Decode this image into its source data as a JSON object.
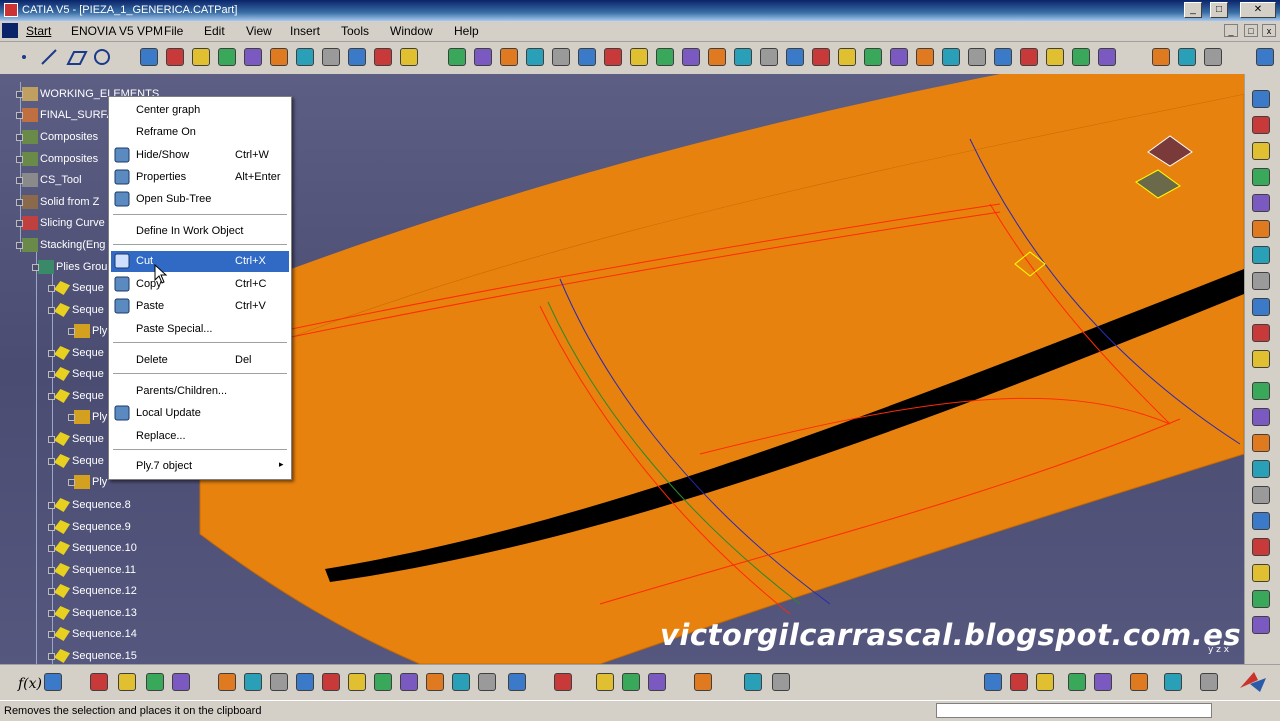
{
  "window": {
    "title": "CATIA V5 - [PIEZA_1_GENERICA.CATPart]"
  },
  "menu": [
    "Start",
    "ENOVIA V5 VPM",
    "File",
    "Edit",
    "View",
    "Insert",
    "Tools",
    "Window",
    "Help"
  ],
  "tree": [
    {
      "label": "WORKING_ELEMENTS"
    },
    {
      "label": "FINAL_SURFA"
    },
    {
      "label": "Composites"
    },
    {
      "label": "Composites"
    },
    {
      "label": "CS_Tool"
    },
    {
      "label": "Solid from Z"
    },
    {
      "label": "Slicing Curve"
    },
    {
      "label": "Stacking(Eng"
    },
    {
      "label": "Plies Grou"
    },
    {
      "label": "Seque"
    },
    {
      "label": "Seque"
    },
    {
      "label": "Ply"
    },
    {
      "label": "Seque"
    },
    {
      "label": "Seque"
    },
    {
      "label": "Seque"
    },
    {
      "label": "Ply"
    },
    {
      "label": "Seque"
    },
    {
      "label": "Seque"
    },
    {
      "label": "Ply"
    },
    {
      "label": "Sequence.8"
    },
    {
      "label": "Sequence.9"
    },
    {
      "label": "Sequence.10"
    },
    {
      "label": "Sequence.11"
    },
    {
      "label": "Sequence.12"
    },
    {
      "label": "Sequence.13"
    },
    {
      "label": "Sequence.14"
    },
    {
      "label": "Sequence.15"
    }
  ],
  "context_menu": {
    "items": [
      {
        "label": "Center graph",
        "shortcut": ""
      },
      {
        "label": "Reframe On",
        "shortcut": ""
      },
      {
        "label": "Hide/Show",
        "shortcut": "Ctrl+W",
        "icon": "hide-show-icon"
      },
      {
        "label": "Properties",
        "shortcut": "Alt+Enter",
        "icon": "properties-icon"
      },
      {
        "label": "Open Sub-Tree",
        "shortcut": "",
        "icon": "open-subtree-icon"
      },
      {
        "label": "Define In Work Object",
        "shortcut": ""
      },
      {
        "label": "Cut",
        "shortcut": "Ctrl+X",
        "icon": "scissors-icon",
        "highlighted": true
      },
      {
        "label": "Copy",
        "shortcut": "Ctrl+C",
        "icon": "copy-icon"
      },
      {
        "label": "Paste",
        "shortcut": "Ctrl+V",
        "icon": "paste-icon"
      },
      {
        "label": "Paste Special...",
        "shortcut": ""
      },
      {
        "label": "Delete",
        "shortcut": "Del"
      },
      {
        "label": "Parents/Children...",
        "shortcut": ""
      },
      {
        "label": "Local Update",
        "shortcut": "",
        "icon": "update-icon"
      },
      {
        "label": "Replace...",
        "shortcut": ""
      },
      {
        "label": "Ply.7 object",
        "shortcut": "",
        "submenu": true
      }
    ]
  },
  "watermark": "victorgilcarrascal.blogspot.com.es",
  "status": {
    "text": "Removes the selection and places it on the clipboard"
  },
  "colors": {
    "surface": "#e8820f",
    "background": "#4f5178",
    "highlight": "#316ac5"
  }
}
